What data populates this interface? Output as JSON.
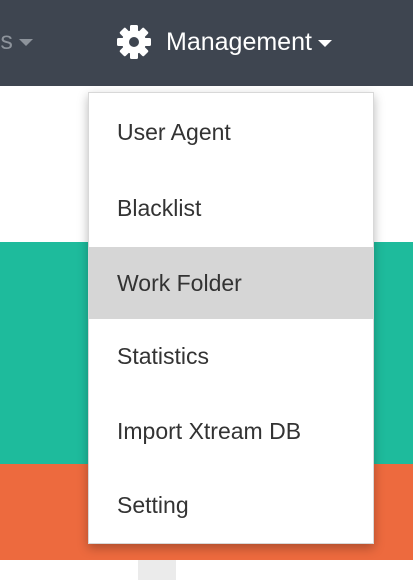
{
  "navbar": {
    "prev_item_label": "rs",
    "management": {
      "icon": "gear-icon",
      "label": "Management"
    }
  },
  "dropdown": {
    "items": [
      {
        "label": "User Agent"
      },
      {
        "label": "Blacklist"
      },
      {
        "label": "Work Folder",
        "state": "hovered"
      },
      {
        "label": "Statistics"
      },
      {
        "label": "Import Xtream DB"
      },
      {
        "label": "Setting"
      }
    ]
  },
  "colors": {
    "navbar_bg": "#3e4550",
    "nav_text": "#ffffff",
    "nav_muted_text": "#8d939b",
    "menu_bg": "#ffffff",
    "menu_hover_bg": "#d6d6d6",
    "menu_text": "#333333",
    "teal_panel": "#1ebb9c",
    "orange_panel": "#ed6a3e"
  }
}
